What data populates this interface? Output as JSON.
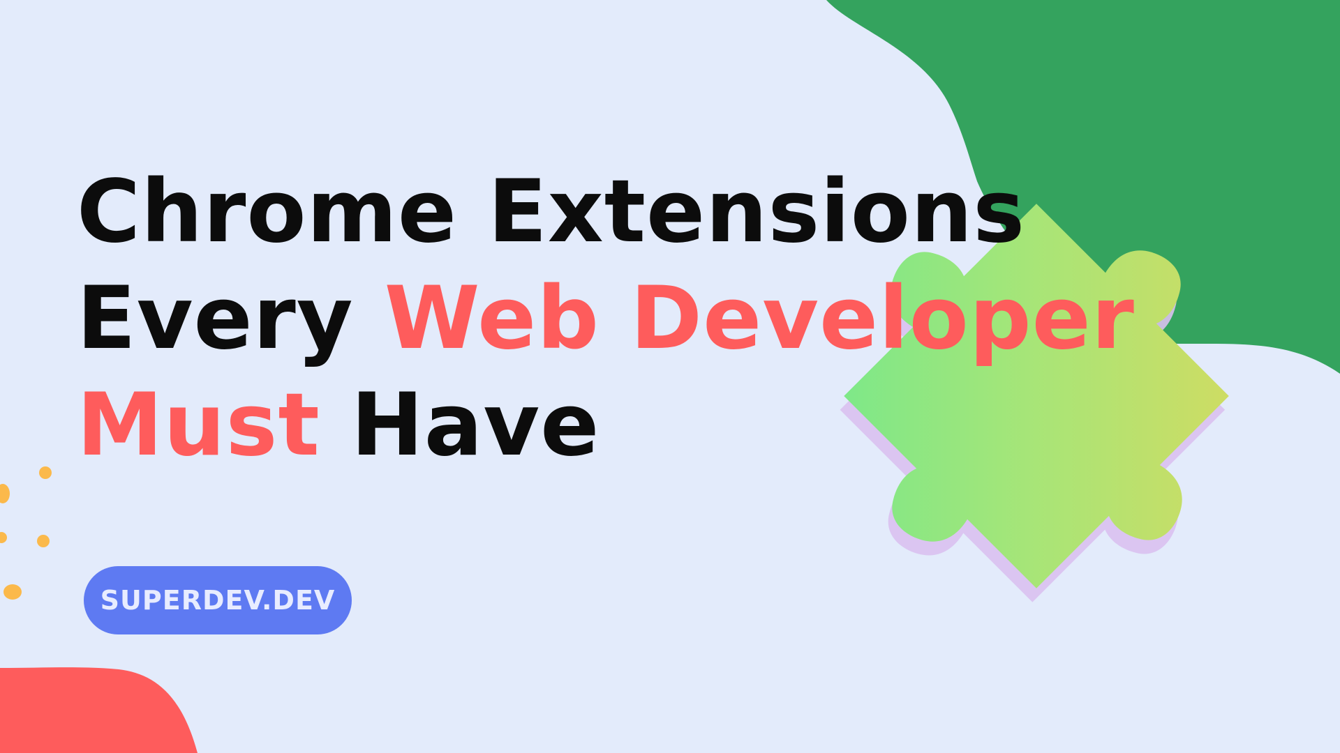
{
  "headline": {
    "line1": "Chrome Extensions",
    "line2_plain": "Every ",
    "line2_accent": "Web Developer",
    "line3_accent": "Must",
    "line3_plain": " Have"
  },
  "brand": {
    "label": "SUPERDEV.DEV"
  },
  "colors": {
    "background": "#e3ebfb",
    "text": "#0c0c0c",
    "accent": "#fe5c5c",
    "green_blob": "#34a35e",
    "red_blob": "#fe5c5c",
    "dots": "#fbb94b",
    "pill": "#5e7af2"
  },
  "icons": {
    "puzzle": "puzzle-piece-icon"
  }
}
